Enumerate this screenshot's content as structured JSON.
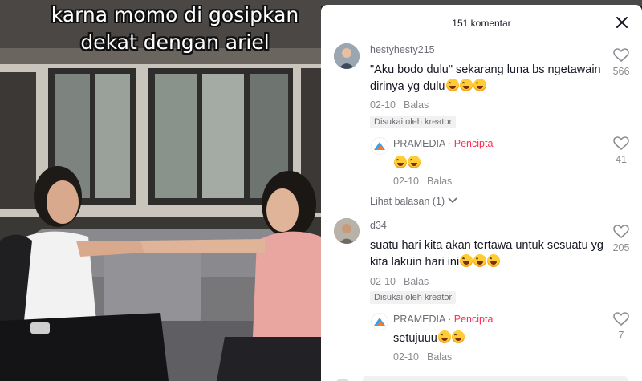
{
  "video": {
    "caption_line1": "karna momo di gosipkan",
    "caption_line2": "dekat dengan ariel"
  },
  "comments_panel": {
    "title": "151 komentar",
    "comments": [
      {
        "username": "hestyhesty215",
        "text": "\"Aku bodo dulu\" sekarang luna bs ngetawain dirinya yg dulu",
        "emoji_count": 3,
        "date": "02-10",
        "reply_label": "Balas",
        "liked_badge": "Disukai oleh kreator",
        "likes": "566",
        "reply": {
          "username": "PRAMEDIA",
          "separator": "·",
          "creator_label": "Pencipta",
          "emoji_count": 2,
          "date": "02-10",
          "reply_label": "Balas",
          "likes": "41"
        },
        "view_replies": "Lihat balasan (1)"
      },
      {
        "username": "d34",
        "text": "suatu hari kita akan tertawa untuk sesuatu yg kita lakuin hari ini",
        "emoji_count": 3,
        "date": "02-10",
        "reply_label": "Balas",
        "liked_badge": "Disukai oleh kreator",
        "likes": "205",
        "reply": {
          "username": "PRAMEDIA",
          "separator": "·",
          "creator_label": "Pencipta",
          "text": "setujuuu",
          "emoji_count": 2,
          "date": "02-10",
          "reply_label": "Balas",
          "likes": "7"
        }
      }
    ]
  },
  "colors": {
    "accent": "#fe2c55",
    "text_primary": "#161823",
    "text_secondary": "#8a8b91"
  },
  "icons": [
    "close-icon",
    "heart-icon",
    "chevron-down-icon",
    "laughing-emoji-icon"
  ]
}
